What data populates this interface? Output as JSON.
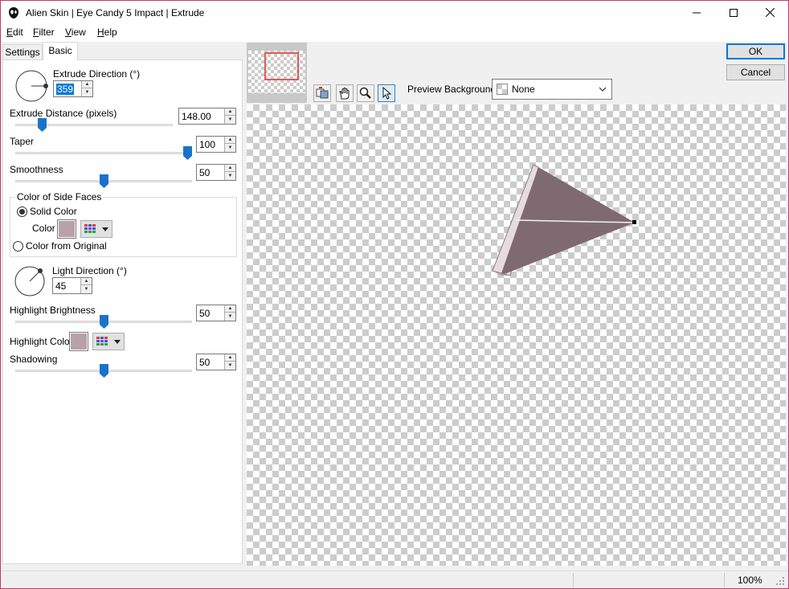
{
  "window": {
    "title": "Alien Skin | Eye Candy 5 Impact | Extrude"
  },
  "menu": {
    "items": [
      {
        "first": "E",
        "rest": "dit"
      },
      {
        "first": "F",
        "rest": "ilter"
      },
      {
        "first": "V",
        "rest": "iew"
      },
      {
        "first": "H",
        "rest": "elp"
      }
    ]
  },
  "tabs": {
    "settings": "Settings",
    "basic": "Basic"
  },
  "basic": {
    "extrude_direction": {
      "label": "Extrude Direction (°)",
      "value": "359"
    },
    "extrude_distance": {
      "label": "Extrude Distance (pixels)",
      "value": "148.00",
      "level": 0.15
    },
    "taper": {
      "label": "Taper",
      "value": "100",
      "level": 1.0
    },
    "smoothness": {
      "label": "Smoothness",
      "value": "50",
      "level": 0.5
    },
    "side_faces": {
      "group_label": "Color of Side Faces",
      "solid_color_label": "Solid Color",
      "color_label": "Color",
      "from_original_label": "Color from Original",
      "selected": "Solid Color",
      "color": "#b9a1a9"
    },
    "light_direction": {
      "label": "Light Direction (°)",
      "value": "45"
    },
    "highlight_brightness": {
      "label": "Highlight Brightness",
      "value": "50",
      "level": 0.5
    },
    "highlight_color": {
      "label": "Highlight Color",
      "color": "#b9a1a9"
    },
    "shadowing": {
      "label": "Shadowing",
      "value": "50",
      "level": 0.5
    }
  },
  "toolbar": {
    "preview_background_label": "Preview Background:",
    "preview_background_value": "None",
    "tools": [
      "compare-icon",
      "hand-icon",
      "zoom-icon",
      "pointer-icon"
    ],
    "active_tool": "pointer-icon"
  },
  "actions": {
    "ok": "OK",
    "cancel": "Cancel"
  },
  "status": {
    "zoom": "100%"
  },
  "colors": {
    "accent": "#0078d7",
    "slider_thumb": "#1a73c9",
    "shape_face": "#7f6a72",
    "shape_side": "#d9ccd0"
  }
}
